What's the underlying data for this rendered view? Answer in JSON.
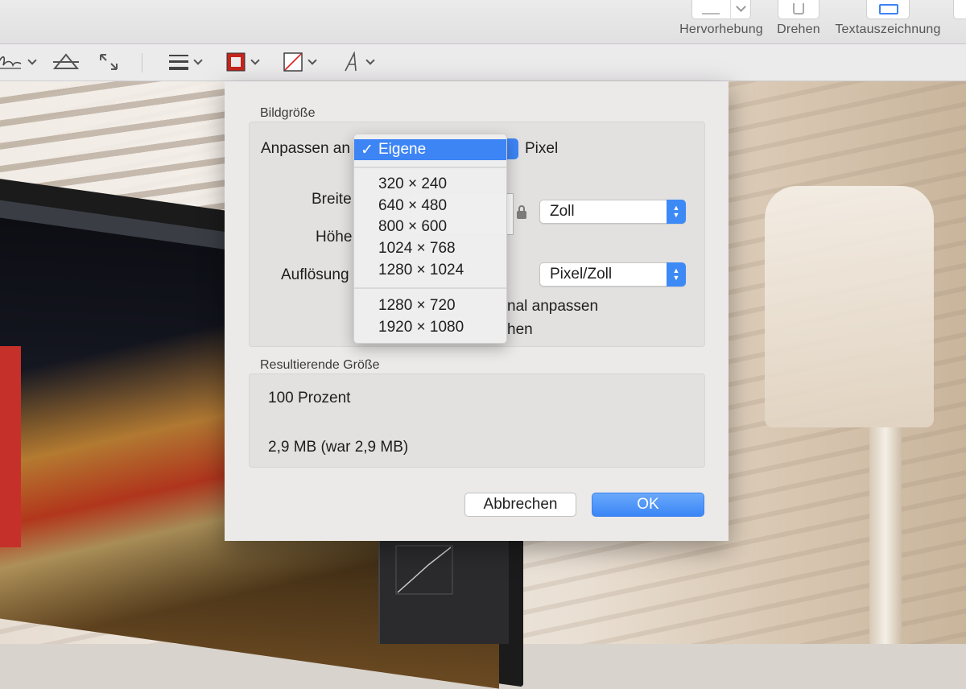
{
  "toolbar": {
    "highlight_label": "Hervorhebung",
    "rotate_label": "Drehen",
    "markup_label": "Textauszeichnung"
  },
  "markup_tools": {
    "items": [
      "sign-icon",
      "adjust-color-icon",
      "adjust-size-icon",
      "shape-style-icon",
      "border-color-icon",
      "fill-color-icon",
      "text-style-icon"
    ]
  },
  "dialog": {
    "image_size_title": "Bildgröße",
    "fit_label": "Anpassen an",
    "fit_unit": "Pixel",
    "width_label": "Breite",
    "height_label": "Höhe",
    "resolution_label": "Auflösung",
    "size_unit": "Zoll",
    "resolution_unit": "Pixel/Zoll",
    "scale_proportional_partial": "nal anpassen",
    "resample_partial": "hen",
    "result_title": "Resultierende Größe",
    "result_percent": "100 Prozent",
    "result_size": "2,9 MB (war 2,9 MB)",
    "cancel_label": "Abbrechen",
    "ok_label": "OK"
  },
  "fit_menu": {
    "selected": "Eigene",
    "check": "✓",
    "group1": [
      "320 × 240",
      "640 × 480",
      "800 × 600",
      "1024 × 768",
      "1280 × 1024"
    ],
    "group2": [
      "1280 × 720",
      "1920 × 1080"
    ]
  }
}
